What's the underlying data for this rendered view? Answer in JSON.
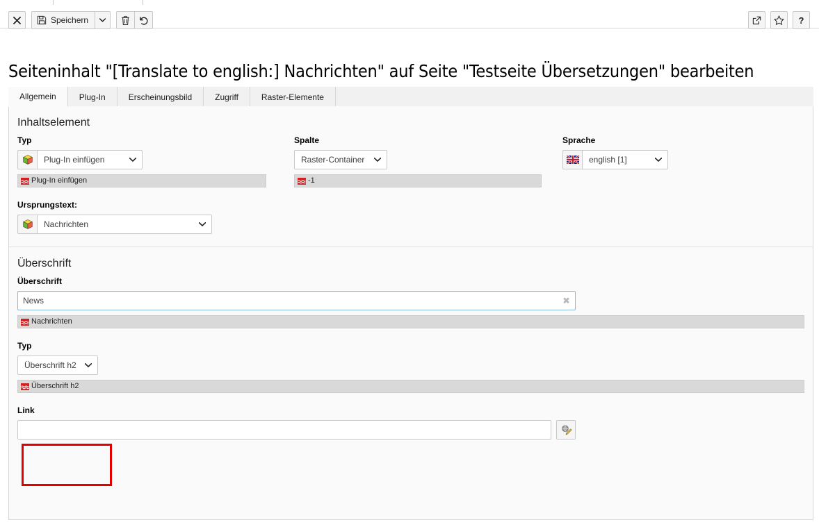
{
  "toolbar": {
    "close_label": "Schließen",
    "save_label": "Speichern",
    "save_options_label": "Weitere Speicheroptionen",
    "delete_label": "Löschen",
    "undo_label": "Rückgängig",
    "open_in_frontend_label": "In Frontend öffnen",
    "bookmark_label": "Lesezeichen setzen",
    "help_label": "?"
  },
  "page": {
    "title": "Seiteninhalt \"[Translate to english:] Nachrichten\" auf Seite \"Testseite Übersetzungen\" bearbeiten"
  },
  "tabs": [
    {
      "label": "Allgemein",
      "active": true
    },
    {
      "label": "Plug-In",
      "active": false
    },
    {
      "label": "Erscheinungsbild",
      "active": false
    },
    {
      "label": "Zugriff",
      "active": false
    },
    {
      "label": "Raster-Elemente",
      "active": false
    }
  ],
  "sections": {
    "content_element": {
      "title": "Inhaltselement",
      "type": {
        "label": "Typ",
        "value": "Plug-In einfügen",
        "icon": "content-plugin-icon",
        "default_language_value": "Plug-In einfügen"
      },
      "column": {
        "label": "Spalte",
        "value": "Raster-Container",
        "default_language_value": "-1"
      },
      "language": {
        "label": "Sprache",
        "value": "english [1]",
        "icon": "flag-uk-icon"
      },
      "source_text": {
        "label": "Ursprungstext:",
        "value": "Nachrichten",
        "icon": "content-plugin-icon"
      }
    },
    "headline": {
      "title": "Überschrift",
      "header": {
        "label": "Überschrift",
        "value": "News",
        "placeholder": "",
        "default_language_value": "Nachrichten"
      },
      "header_type": {
        "label": "Typ",
        "value": "Überschrift h2",
        "default_language_value": "Überschrift h2"
      },
      "link": {
        "label": "Link",
        "value": "",
        "placeholder": "",
        "browse_label": "Link-Browser öffnen"
      }
    }
  },
  "colors": {
    "annotation": "#e30000",
    "focus_border": "#88b7e0",
    "diff_bar": "#d9d9d9",
    "panel_bg": "#fafafa"
  }
}
